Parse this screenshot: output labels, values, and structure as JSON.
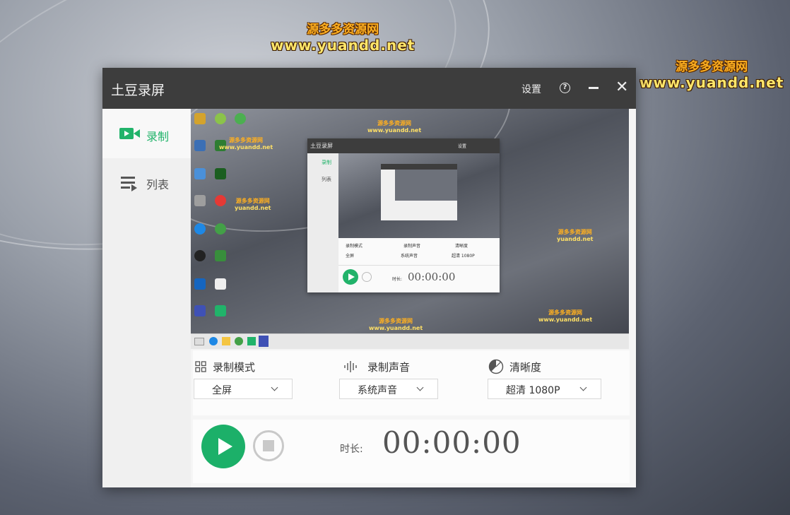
{
  "watermarks": [
    {
      "cn": "源多多资源网",
      "url": "www.yuandd.net"
    },
    {
      "cn": "源多多资源网",
      "url": "www.yuandd.net"
    }
  ],
  "window": {
    "title": "土豆录屏",
    "settings_label": "设置",
    "help_icon": "help-circle-icon",
    "minimize_icon": "minimize-icon",
    "close_icon": "close-icon"
  },
  "sidebar": {
    "items": [
      {
        "label": "录制",
        "icon": "video-camera-icon",
        "active": true
      },
      {
        "label": "列表",
        "icon": "list-icon",
        "active": false
      }
    ]
  },
  "preview": {
    "nested_title": "土豆录屏",
    "nested_settings": "设置",
    "nested_nav": [
      "录制",
      "列表"
    ],
    "nested_options": [
      {
        "label": "录制模式",
        "value": "全屏"
      },
      {
        "label": "录制声音",
        "value": "系统声音"
      },
      {
        "label": "清晰度",
        "value": "超清 1080P"
      }
    ],
    "nested_duration_label": "时长:",
    "nested_duration": "00:00:00",
    "overlay_texts": [
      {
        "cn": "源多多资源网",
        "url": "www.yuandd.net"
      },
      {
        "cn": "源多多资源网",
        "url": "www.yuandd.net"
      },
      {
        "cn": "源多多资源网",
        "url": "yuandd.net"
      },
      {
        "cn": "源多多资源网",
        "url": "yuandd.net"
      },
      {
        "cn": "源多多资源网",
        "url": "www.yuandd.net"
      },
      {
        "cn": "源多多资源网",
        "url": "www.yuandd.net"
      }
    ]
  },
  "options": {
    "mode": {
      "label": "录制模式",
      "value": "全屏",
      "icon": "grid-icon"
    },
    "audio": {
      "label": "录制声音",
      "value": "系统声音",
      "icon": "sound-wave-icon"
    },
    "quality": {
      "label": "清晰度",
      "value": "超清 1080P",
      "icon": "quality-dial-icon"
    }
  },
  "controls": {
    "play_icon": "play-icon",
    "stop_icon": "stop-icon",
    "duration_label": "时长:",
    "duration_value": "00:00:00"
  },
  "colors": {
    "accent": "#1cb069",
    "titlebar": "#3d3d3d"
  }
}
